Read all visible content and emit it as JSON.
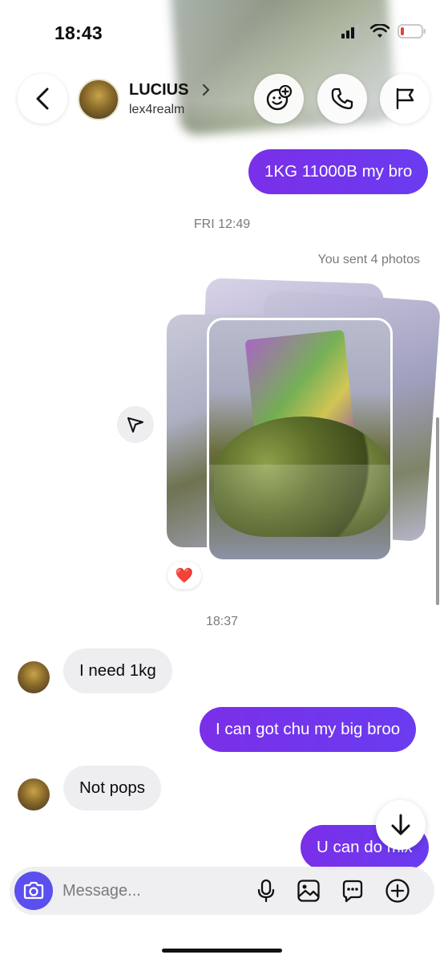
{
  "status": {
    "time": "18:43"
  },
  "header": {
    "name": "LUCIUS",
    "username": "lex4realm"
  },
  "messages": {
    "m1": "1KG 11000B my bro",
    "ts1": "FRI 12:49",
    "photos_note": "You sent 4 photos",
    "reaction": "❤️",
    "ts2": "18:37",
    "m2": "I need 1kg",
    "m3": "I can got chu my big broo",
    "m4": "Not pops",
    "m5": "U can do mix"
  },
  "composer": {
    "placeholder": "Message..."
  },
  "colors": {
    "sent_bubble": "#6a3cf0",
    "received_bubble": "#eeeef1",
    "camera_button": "#5b4ff0"
  }
}
